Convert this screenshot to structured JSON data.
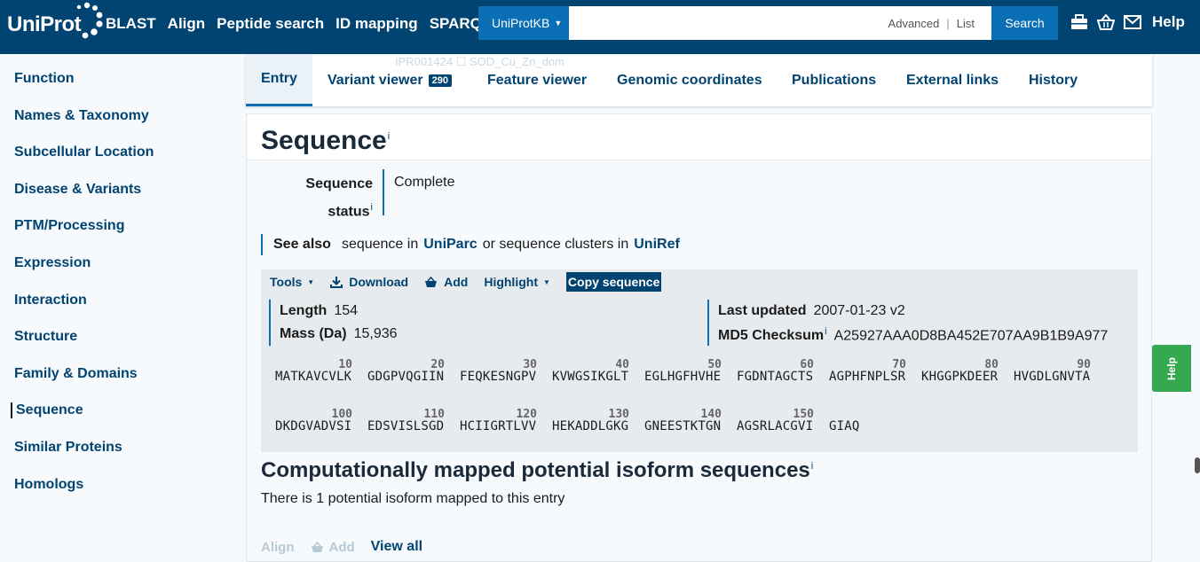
{
  "header": {
    "logo_text": "UniProt",
    "nav": [
      "BLAST",
      "Align",
      "Peptide search",
      "ID mapping",
      "SPARQL"
    ],
    "db_select": "UniProtKB",
    "search_placeholder": "",
    "advanced": "Advanced",
    "list": "List",
    "search_button": "Search",
    "help": "Help",
    "icons": [
      "toolbox-icon",
      "basket-icon",
      "envelope-icon"
    ]
  },
  "sidebar": {
    "items": [
      "Function",
      "Names & Taxonomy",
      "Subcellular Location",
      "Disease & Variants",
      "PTM/Processing",
      "Expression",
      "Interaction",
      "Structure",
      "Family & Domains",
      "Sequence",
      "Similar Proteins",
      "Homologs"
    ],
    "active": "Sequence"
  },
  "ghost_text": "IPR001424 ☐ SOD_Cu_Zn_dom",
  "tabs": [
    {
      "label": "Entry",
      "active": true
    },
    {
      "label": "Variant viewer",
      "badge": "290"
    },
    {
      "label": "Feature viewer"
    },
    {
      "label": "Genomic coordinates"
    },
    {
      "label": "Publications"
    },
    {
      "label": "External links"
    },
    {
      "label": "History"
    }
  ],
  "sequence_section": {
    "title": "Sequence",
    "info_marker": "i",
    "status_label_1": "Sequence",
    "status_label_2": "status",
    "status_value": "Complete",
    "see_also_label": "See also",
    "see_also_text_1": "sequence in",
    "see_also_link_1": "UniParc",
    "see_also_text_2": "or sequence clusters in",
    "see_also_link_2": "UniRef",
    "toolbar": {
      "tools": "Tools",
      "download": "Download",
      "add": "Add",
      "highlight": "Highlight",
      "copy": "Copy sequence"
    },
    "length_label": "Length",
    "length_value": "154",
    "mass_label": "Mass (Da)",
    "mass_value": "15,936",
    "updated_label": "Last updated",
    "updated_value": "2007-01-23 v2",
    "checksum_label": "MD5 Checksum",
    "checksum_value": "A25927AAA0D8BA452E707AA9B1B9A977",
    "blocks": [
      {
        "num": "10",
        "aa": "MATKAVCVLK"
      },
      {
        "num": "20",
        "aa": "GDGPVQGIIN"
      },
      {
        "num": "30",
        "aa": "FEQKESNGPV"
      },
      {
        "num": "40",
        "aa": "KVWGSIKGLT"
      },
      {
        "num": "50",
        "aa": "EGLHGFHVHE"
      },
      {
        "num": "60",
        "aa": "FGDNTAGCTS"
      },
      {
        "num": "70",
        "aa": "AGPHFNPLSR"
      },
      {
        "num": "80",
        "aa": "KHGGPKDEER"
      },
      {
        "num": "90",
        "aa": "HVGDLGNVTA"
      },
      {
        "num": "100",
        "aa": "DKDGVADVSI"
      },
      {
        "num": "110",
        "aa": "EDSVISLSGD"
      },
      {
        "num": "120",
        "aa": "HCIIGRTLVV"
      },
      {
        "num": "130",
        "aa": "HEKADDLGKG"
      },
      {
        "num": "140",
        "aa": "GNEESTKTGN"
      },
      {
        "num": "150",
        "aa": "AGSRLACGVI"
      },
      {
        "num": "",
        "aa": "GIAQ"
      }
    ]
  },
  "isoform_section": {
    "title": "Computationally mapped potential isoform sequences",
    "text": "There is 1 potential isoform mapped to this entry",
    "align": "Align",
    "add": "Add",
    "view_all": "View all"
  },
  "help_tab": "Help",
  "colors": {
    "header_bg": "#014371",
    "accent": "#0a6fb5",
    "help_green": "#36a852"
  }
}
